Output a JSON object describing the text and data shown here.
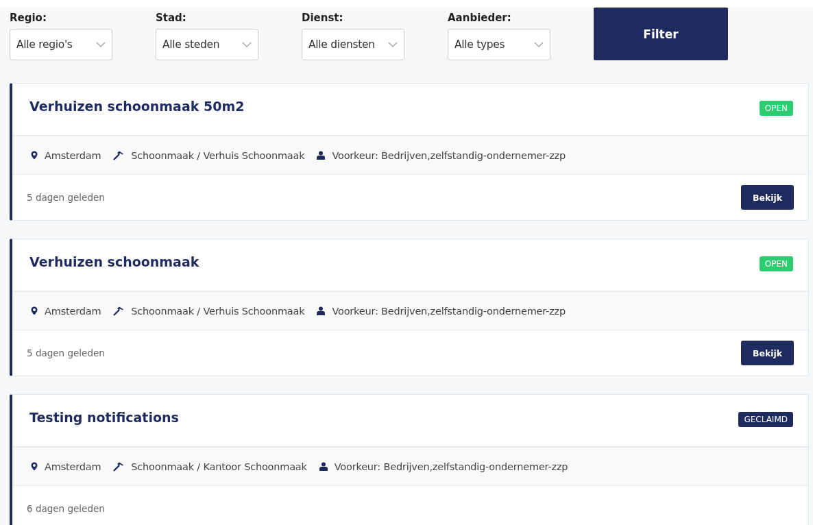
{
  "filters": [
    {
      "label": "Regio:",
      "value": "Alle regio's"
    },
    {
      "label": "Stad:",
      "value": "Alle steden"
    },
    {
      "label": "Dienst:",
      "value": "Alle diensten"
    },
    {
      "label": "Aanbieder:",
      "value": "Alle types"
    }
  ],
  "filter_button": "Filter",
  "jobs": [
    {
      "title": "Verhuizen schoonmaak 50m2",
      "status": {
        "kind": "open",
        "label": "OPEN"
      },
      "city": "Amsterdam",
      "service": "Schoonmaak / Verhuis Schoonmaak",
      "preference": "Voorkeur: Bedrijven,zelfstandig-ondernemer-zzp",
      "posted": "5 dagen geleden",
      "button": "Bekijk"
    },
    {
      "title": "Verhuizen schoonmaak",
      "status": {
        "kind": "open",
        "label": "OPEN"
      },
      "city": "Amsterdam",
      "service": "Schoonmaak / Verhuis Schoonmaak",
      "preference": "Voorkeur: Bedrijven,zelfstandig-ondernemer-zzp",
      "posted": "5 dagen geleden",
      "button": "Bekijk"
    },
    {
      "title": "Testing notifications",
      "status": {
        "kind": "claimed",
        "label": "GECLAIMD"
      },
      "city": "Amsterdam",
      "service": "Schoonmaak / Kantoor Schoonmaak",
      "preference": "Voorkeur: Bedrijven,zelfstandig-ondernemer-zzp",
      "posted": "6 dagen geleden"
    }
  ]
}
